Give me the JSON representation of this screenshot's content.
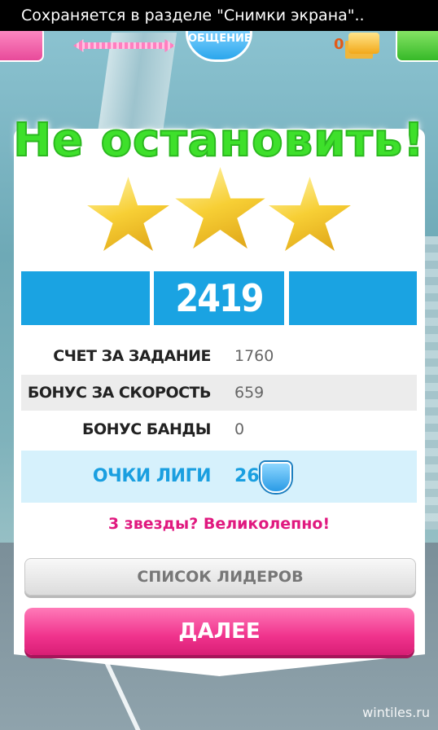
{
  "status_bar": {
    "text": "Сохраняется в разделе \"Снимки экрана\".."
  },
  "header": {
    "badge_label": "ОБЩЕНИЕ",
    "coins": "0"
  },
  "result": {
    "headline": "Не остановить!",
    "stars_earned": 3,
    "stars_total": 3,
    "score": "2419",
    "rows": [
      {
        "label": "СЧЕТ ЗА ЗАДАНИЕ",
        "value": "1760"
      },
      {
        "label": "БОНУС ЗА СКОРОСТЬ",
        "value": "659"
      },
      {
        "label": "БОНУС БАНДЫ",
        "value": "0"
      }
    ],
    "league": {
      "label": "ОЧКИ ЛИГИ",
      "value": "26"
    },
    "praise": "3 звезды? Великолепно!",
    "leaders_button": "СПИСОК ЛИДЕРОВ",
    "next_button": "ДАЛЕЕ"
  },
  "watermark": "wintiles.ru",
  "colors": {
    "accent_blue": "#1aa3e2",
    "headline_green": "#3ee02b",
    "pink": "#f0338d"
  }
}
